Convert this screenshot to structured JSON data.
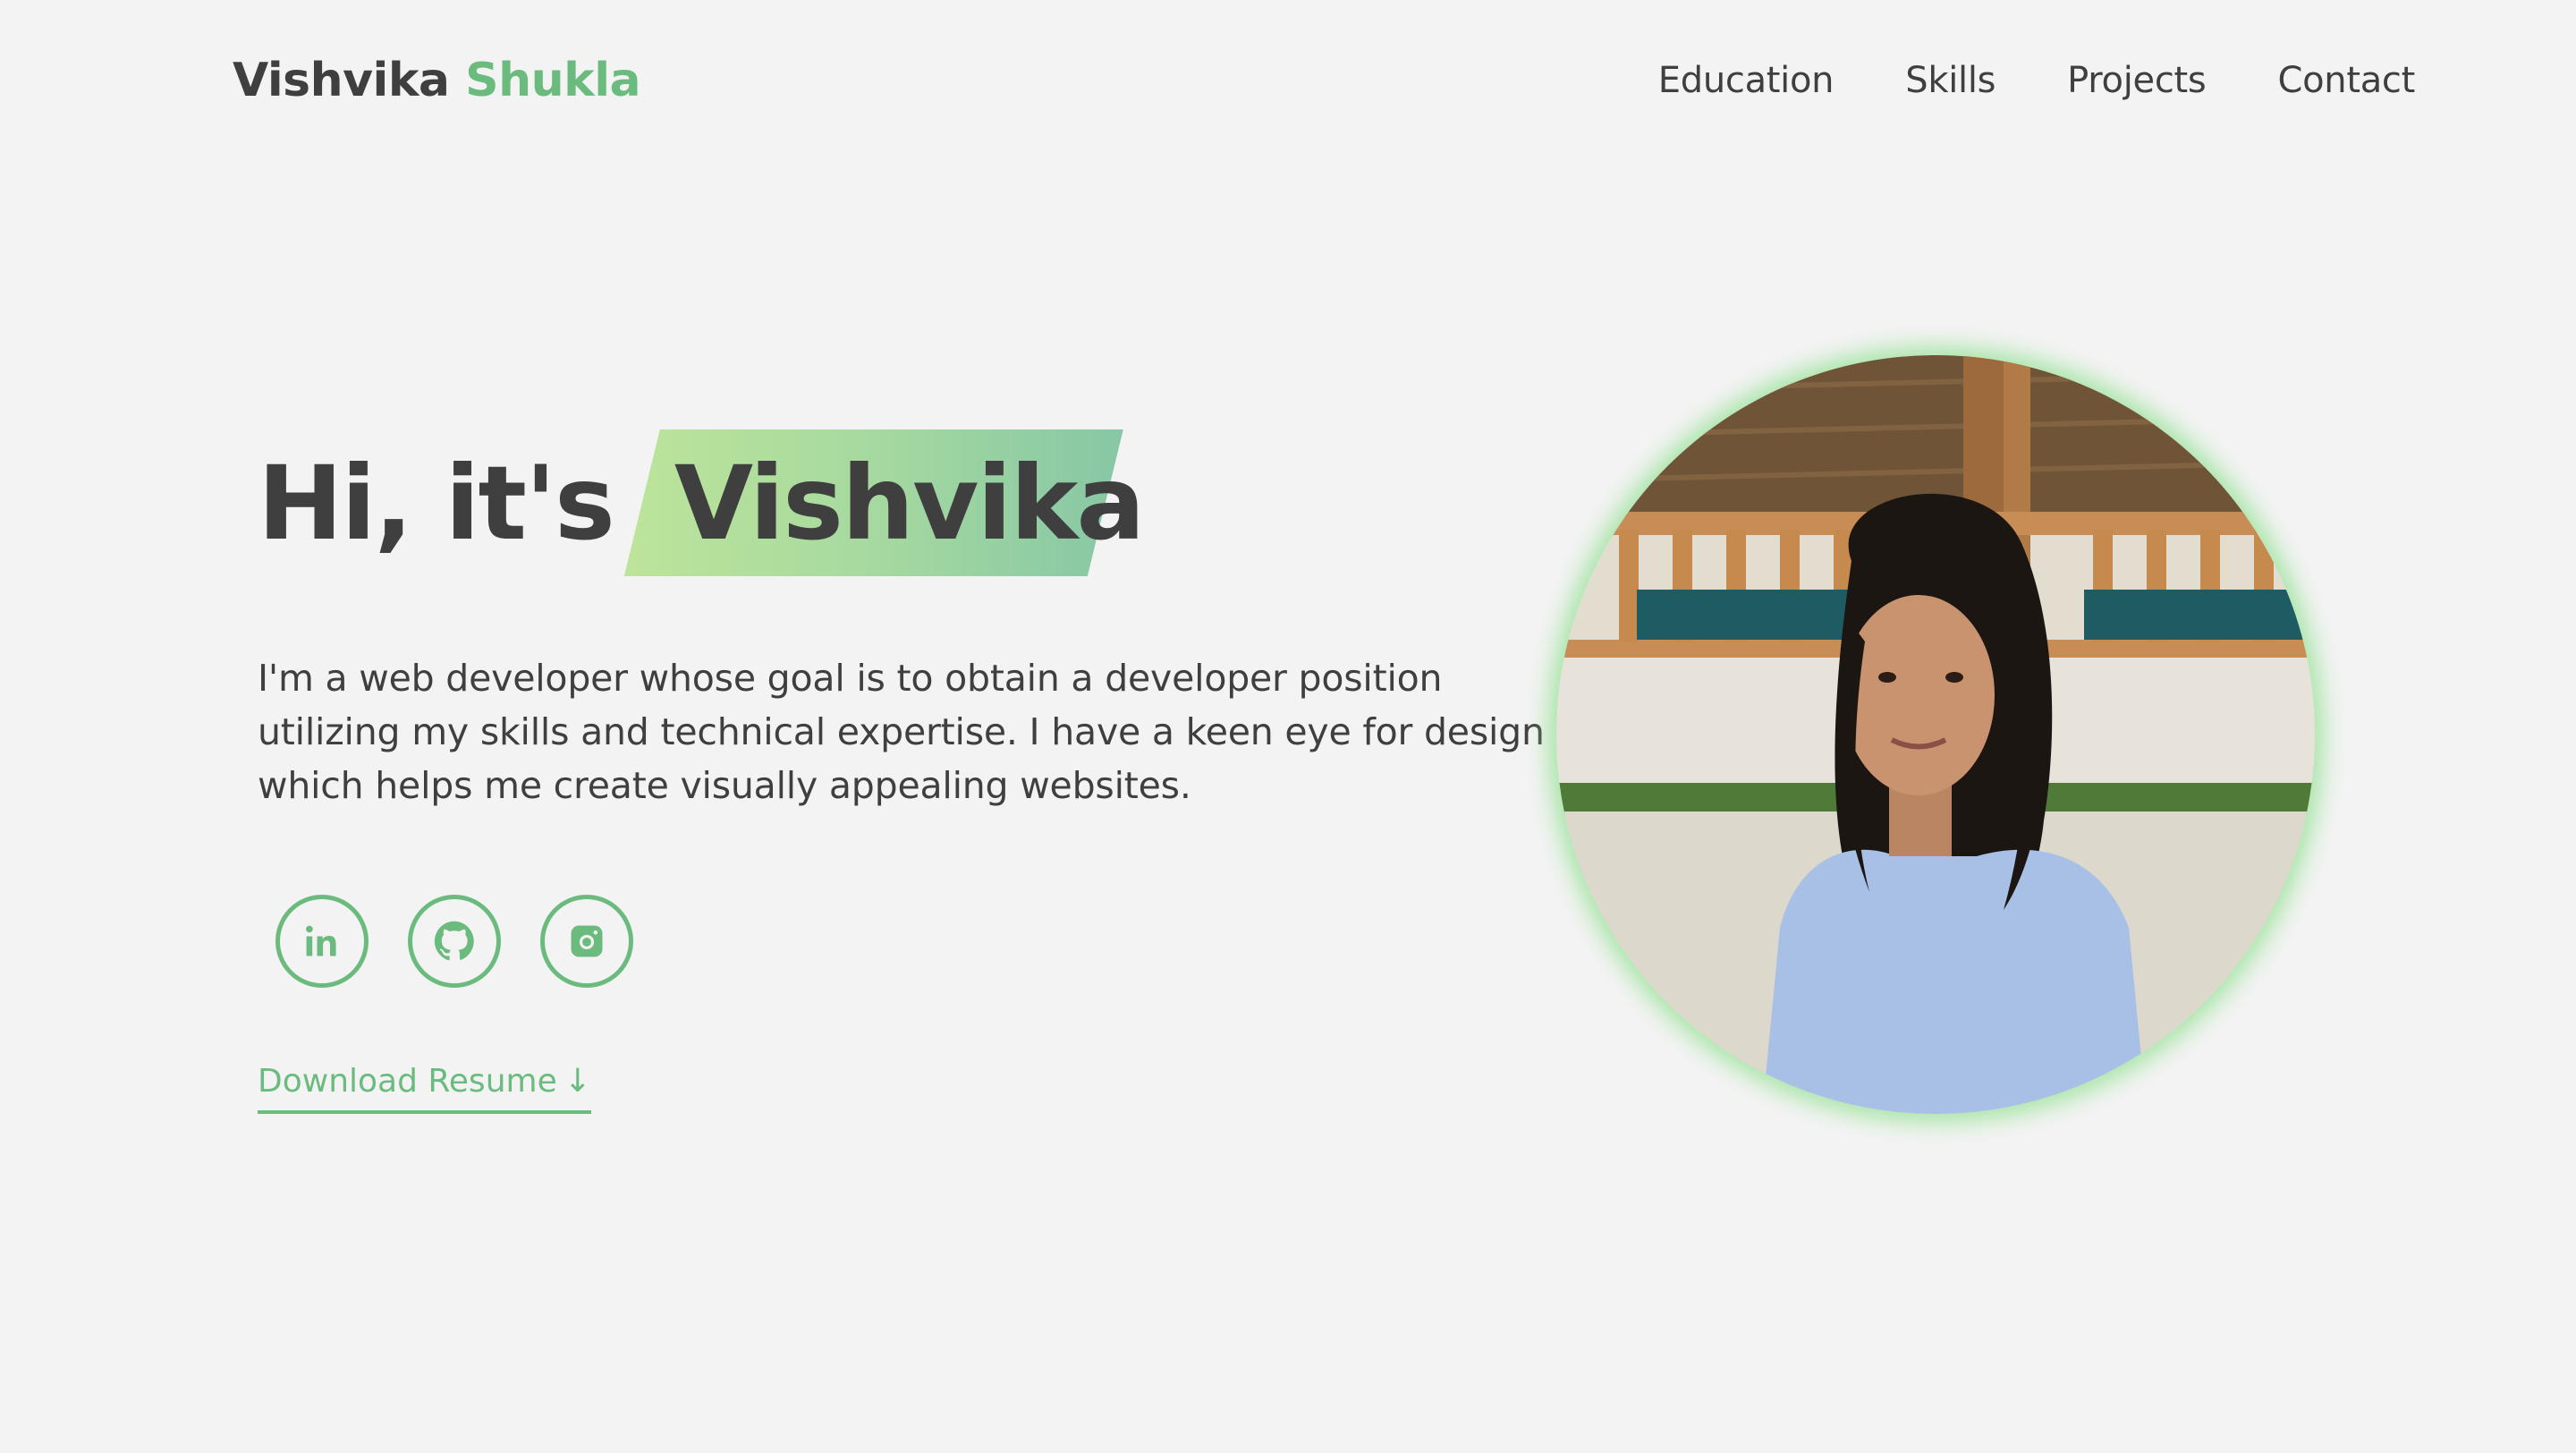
{
  "header": {
    "logo_first": "Vishvika",
    "logo_last": "Shukla",
    "nav": [
      "Education",
      "Skills",
      "Projects",
      "Contact"
    ]
  },
  "hero": {
    "greeting": "Hi, it's",
    "name": "Vishvika",
    "description": "I'm a web developer whose goal is to obtain a developer position utilizing my skills and technical expertise. I have a keen eye for design which helps me create visually appealing websites.",
    "download_label": "Download Resume",
    "download_arrow": "↓"
  },
  "socials": [
    {
      "icon": "linkedin-icon"
    },
    {
      "icon": "github-icon"
    },
    {
      "icon": "instagram-icon"
    }
  ],
  "colors": {
    "accent": "#6bbb7f",
    "text": "#3f3f3f",
    "background": "#f3f3f3",
    "highlight_start": "#bde49a",
    "highlight_end": "#87c7a5"
  }
}
